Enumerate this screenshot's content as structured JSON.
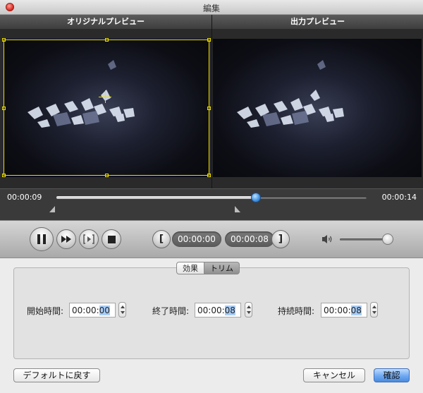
{
  "window": {
    "title": "編集"
  },
  "preview": {
    "original_label": "オリジナルプレビュー",
    "output_label": "出力プレビュー"
  },
  "timeline": {
    "current_time": "00:00:09",
    "end_time": "00:00:14",
    "progress": 0.643
  },
  "controls": {
    "start_time": "00:00:00",
    "end_time": "00:00:08",
    "start_bracket": "[",
    "end_bracket": "]",
    "volume": 0.9
  },
  "tabs": [
    {
      "label": "効果",
      "active": false
    },
    {
      "label": "トリム",
      "active": true
    }
  ],
  "trim": {
    "start": {
      "label": "開始時間:",
      "value_prefix": "00:00:",
      "value_selected": "00"
    },
    "end": {
      "label": "終了時間:",
      "value_prefix": "00:00:",
      "value_selected": "08"
    },
    "duration": {
      "label": "持続時間:",
      "value_prefix": "00:00:",
      "value_selected": "08"
    }
  },
  "buttons": {
    "default": "デフォルトに戻す",
    "cancel": "キャンセル",
    "confirm": "確認"
  },
  "colors": {
    "crop_frame": "#f0e000",
    "accent": "#3f8fe0",
    "close": "#d8261d"
  }
}
